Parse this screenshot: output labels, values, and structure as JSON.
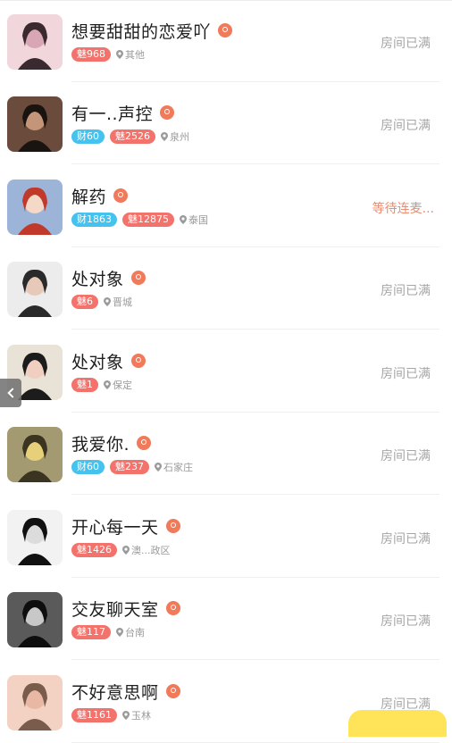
{
  "rooms": [
    {
      "name": "想要甜甜的恋爱吖",
      "badges": [
        {
          "kind": "mei",
          "text": "魅968"
        }
      ],
      "location": "其他",
      "status": "房间已满",
      "avatar_colors": [
        "#f1d6dc",
        "#d8a6b4",
        "#3a2a30"
      ]
    },
    {
      "name": "有一..声控",
      "badges": [
        {
          "kind": "cai",
          "text": "财60"
        },
        {
          "kind": "mei",
          "text": "魅2526"
        }
      ],
      "location": "泉州",
      "status": "房间已满",
      "avatar_colors": [
        "#6a4b3c",
        "#c49579",
        "#1a1410"
      ]
    },
    {
      "name": "解药",
      "badges": [
        {
          "kind": "cai",
          "text": "财1863"
        },
        {
          "kind": "mei",
          "text": "魅12875"
        }
      ],
      "location": "泰国",
      "status": "等待连麦...",
      "status_style": "waiting",
      "avatar_colors": [
        "#9bb4d8",
        "#f3d9c6",
        "#c0392b"
      ]
    },
    {
      "name": "处对象",
      "badges": [
        {
          "kind": "mei",
          "text": "魅6"
        }
      ],
      "location": "晋城",
      "status": "房间已满",
      "avatar_colors": [
        "#ececec",
        "#e6c9b8",
        "#2a2a2a"
      ]
    },
    {
      "name": "处对象",
      "badges": [
        {
          "kind": "mei",
          "text": "魅1"
        }
      ],
      "location": "保定",
      "status": "房间已满",
      "avatar_colors": [
        "#e9e2d6",
        "#f0cfc0",
        "#1c1c1c"
      ]
    },
    {
      "name": "我爱你.",
      "badges": [
        {
          "kind": "cai",
          "text": "财60"
        },
        {
          "kind": "mei",
          "text": "魅237"
        }
      ],
      "location": "石家庄",
      "status": "房间已满",
      "avatar_colors": [
        "#a49a72",
        "#e6d07a",
        "#3b3420"
      ]
    },
    {
      "name": "开心每一天",
      "badges": [
        {
          "kind": "mei",
          "text": "魅1426"
        }
      ],
      "location": "澳...政区",
      "status": "房间已满",
      "avatar_colors": [
        "#f2f2f2",
        "#dcdcdc",
        "#111111"
      ]
    },
    {
      "name": "交友聊天室",
      "badges": [
        {
          "kind": "mei",
          "text": "魅117"
        }
      ],
      "location": "台南",
      "status": "房间已满",
      "avatar_colors": [
        "#5a5a5a",
        "#c8c8c8",
        "#0e0e0e"
      ]
    },
    {
      "name": "不好意思啊",
      "badges": [
        {
          "kind": "mei",
          "text": "魅1161"
        }
      ],
      "location": "玉林",
      "status": "房间已满",
      "avatar_colors": [
        "#f3d2c4",
        "#e8b8a4",
        "#7a5c4c"
      ]
    }
  ],
  "colors": {
    "cai_badge": "#46c2ee",
    "mei_badge": "#f3736c",
    "waiting_status": "#ee8a6e",
    "full_status": "#a6a6a6"
  },
  "icons": {
    "name_suffix": "location-badge-icon",
    "place_prefix": "map-pin-icon",
    "side": "chevron-left-icon"
  }
}
